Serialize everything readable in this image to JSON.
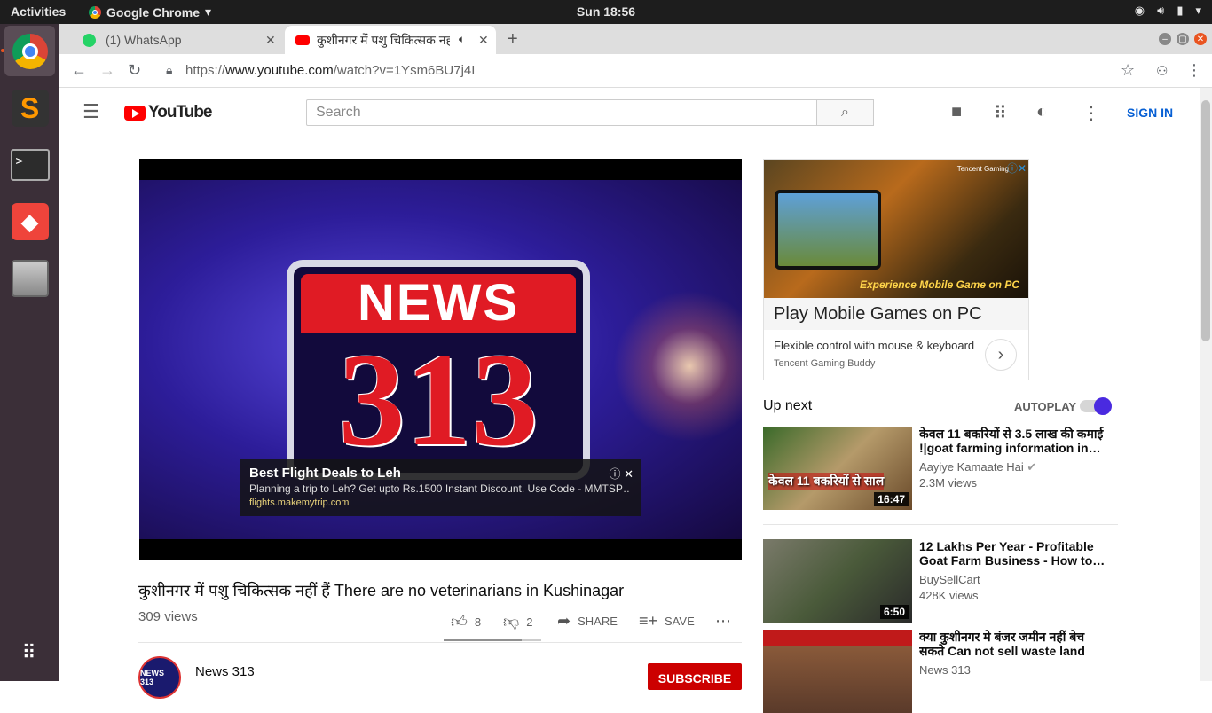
{
  "topbar": {
    "activities": "Activities",
    "app_name": "Google Chrome",
    "clock": "Sun 18:56"
  },
  "tabs": [
    {
      "label": "(1) WhatsApp"
    },
    {
      "label": "कुशीनगर में पशु चिकित्सक नहीं"
    }
  ],
  "address": {
    "prefix": "https://",
    "domain": "www.youtube.com",
    "path": "/watch?v=1Ysm6BU7j4I"
  },
  "youtube": {
    "logo_text": "YouTube",
    "search_placeholder": "Search",
    "sign_in": "SIGN IN"
  },
  "player": {
    "logo_top": "NEWS",
    "logo_number": "313",
    "ad": {
      "title": "Best Flight Deals to Leh",
      "description": "Planning a trip to Leh? Get upto Rs.1500 Instant Discount. Use Code - MMTSP…",
      "url": "flights.makemytrip.com"
    }
  },
  "video": {
    "title": "कुशीनगर में पशु चिकित्सक नहीं हैं There are no veterinarians in Kushinagar",
    "views": "309 views",
    "likes": "8",
    "dislikes": "2",
    "like_fraction": 0.8,
    "share": "SHARE",
    "save": "SAVE",
    "channel": "News 313",
    "avatar_text": "NEWS 313",
    "subscribe": "SUBSCRIBE"
  },
  "side_ad": {
    "brand": "Tencent Gaming",
    "tagline": "Experience Mobile Game on PC",
    "headline": "Play Mobile Games on PC",
    "subtext": "Flexible control with mouse & keyboard",
    "advertiser": "Tencent Gaming Buddy"
  },
  "upnext": {
    "label": "Up next",
    "autoplay": "AUTOPLAY",
    "autoplay_on": true,
    "items": [
      {
        "title": "केवल 11 बकरियों से 3.5 लाख की कमाई !|goat farming information in…",
        "channel": "Aayiye Kamaate Hai",
        "views": "2.3M views",
        "duration": "16:47"
      },
      {
        "title": "12 Lakhs Per Year - Profitable Goat Farm Business - How to…",
        "channel": "BuySellCart",
        "views": "428K views",
        "duration": "6:50"
      },
      {
        "title": "क्या कुशीनगर मे बंजर जमीन नहीं बेच सकते Can not sell waste land in…",
        "channel": "News 313",
        "views": "",
        "duration": ""
      }
    ]
  }
}
